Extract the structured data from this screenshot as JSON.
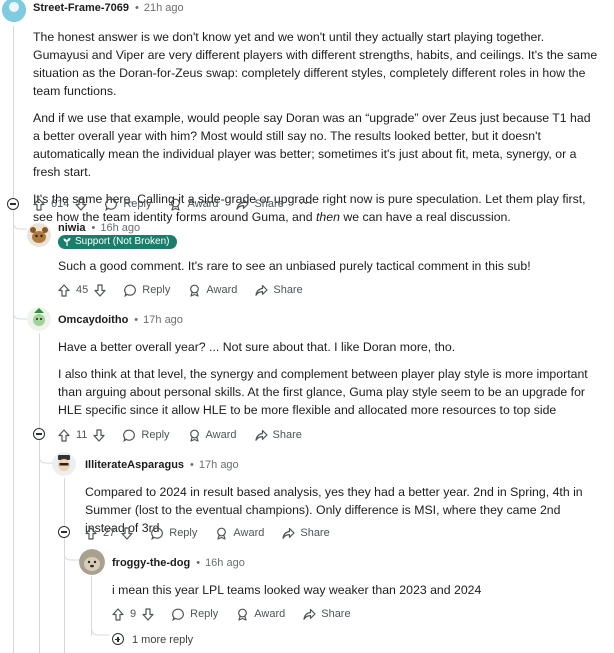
{
  "comments": [
    {
      "user": "Street-Frame-7069",
      "time": "21h ago",
      "paragraphs": [
        "The honest answer is we don't know yet and we won't until they actually start playing together. Gumayusi and Viper are very different players with different strengths, habits, and ceilings. It's the same situation as the Doran-for-Zeus swap: completely different styles, completely different roles in how the team functions.",
        "And if we use that example, would people say Doran was an “upgrade” over Zeus just because T1 had a better overall year with him? Most would still say no. The results looked better, but it doesn't automatically mean the individual player was better; sometimes it's just about fit, meta, synergy, or a fresh start.",
        "It's the same here. Calling it a side-grade or upgrade right now is pure speculation. Let them play first, see how the team identity forms around Guma, and |then| we can have a real discussion."
      ],
      "para3_pre": "It's the same here. Calling it a side-grade or upgrade right now is pure speculation. Let them play first, see how the team identity forms around Guma, and ",
      "para3_em": "then",
      "para3_post": " we can have a real discussion.",
      "votes": "614"
    },
    {
      "user": "niwia",
      "time": "16h ago",
      "flair": "Support (Not Broken)",
      "paragraphs": [
        "Such a good comment. It's rare to see an unbiased purely tactical comment in this sub!"
      ],
      "votes": "45"
    },
    {
      "user": "Omcaydoitho",
      "time": "17h ago",
      "paragraphs": [
        "Have a better overall year? ... Not sure about that. I like Doran more, tho.",
        "I also think at that level, the synergy and complement between player play style is more important than arguing about personal skills. At the first glance, Guma play style seem to be an upgrade for HLE specific since it allow HLE to be more flexible and allocated more resources to top side"
      ],
      "votes": "11"
    },
    {
      "user": "IlliterateAsparagus",
      "time": "17h ago",
      "paragraphs": [
        "Compared to 2024 in result based analysis, yes they had a better year. 2nd in Spring, 4th in Summer (lost to the eventual champions). Only difference is MSI, where they came 2nd instead of 3rd"
      ],
      "votes": "27"
    },
    {
      "user": "froggy-the-dog",
      "time": "16h ago",
      "paragraphs": [
        "i mean this year LPL teams looked way weaker than 2023 and 2024"
      ],
      "votes": "9"
    }
  ],
  "actions": {
    "reply": "Reply",
    "award": "Award",
    "share": "Share",
    "more": "···"
  },
  "more_replies": "1 more reply",
  "separator": "•",
  "colors": {
    "flair_bg": "#1a7f6a",
    "rail": "#d6dadd",
    "text": "#1c1c1c",
    "muted": "#6b6f72"
  },
  "icons": [
    "upvote-icon",
    "downvote-icon",
    "reply-icon",
    "award-icon",
    "share-icon",
    "collapse-icon",
    "expand-icon",
    "flair-plant-icon"
  ]
}
